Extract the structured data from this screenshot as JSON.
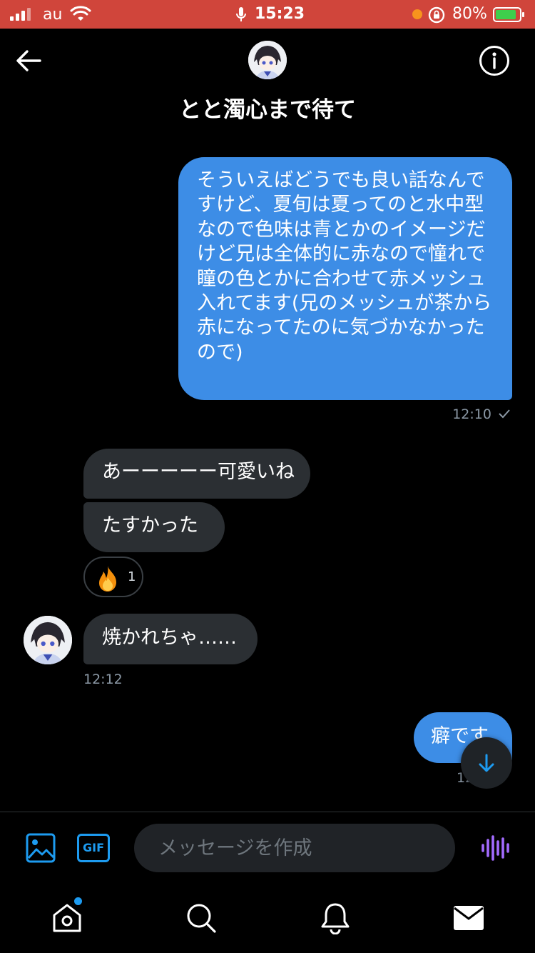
{
  "status_bar": {
    "carrier": "au",
    "time": "15:23",
    "battery": "80%",
    "battery_level": 0.8,
    "bar_color": "#d0453b"
  },
  "header": {
    "title": "とと濁心まで待て",
    "back_icon": "arrow-left-icon",
    "info_icon": "info-icon"
  },
  "messages": [
    {
      "direction": "outgoing",
      "text": "そういえばどうでも良い話なんですけど、夏旬は夏ってのと水中型なので色味は青とかのイメージだけど兄は全体的に赤なので憧れで瞳の色とかに合わせて赤メッシュ入れてます(兄のメッシュが茶から赤になってたのに気づかなかったので)",
      "time": "12:10",
      "status_icon": "check-icon"
    },
    {
      "direction": "incoming",
      "text": "あーーーーー可愛いね"
    },
    {
      "direction": "incoming",
      "text": "たすかった",
      "reaction": {
        "emoji": "🔥",
        "count": "1"
      }
    },
    {
      "direction": "incoming",
      "text": "焼かれちゃ……",
      "time": "12:12"
    },
    {
      "direction": "outgoing",
      "text": "癖です",
      "time": "12"
    }
  ],
  "composer": {
    "placeholder": "メッセージを作成",
    "gif_label": "GIF"
  },
  "colors": {
    "accent": "#1d9bf0",
    "outgoing_bubble": "#3d8de6",
    "incoming_bubble": "#2b2f33",
    "voice_icon": "#a36bff"
  },
  "nav": [
    "home-icon",
    "search-icon",
    "bell-icon",
    "mail-icon"
  ]
}
